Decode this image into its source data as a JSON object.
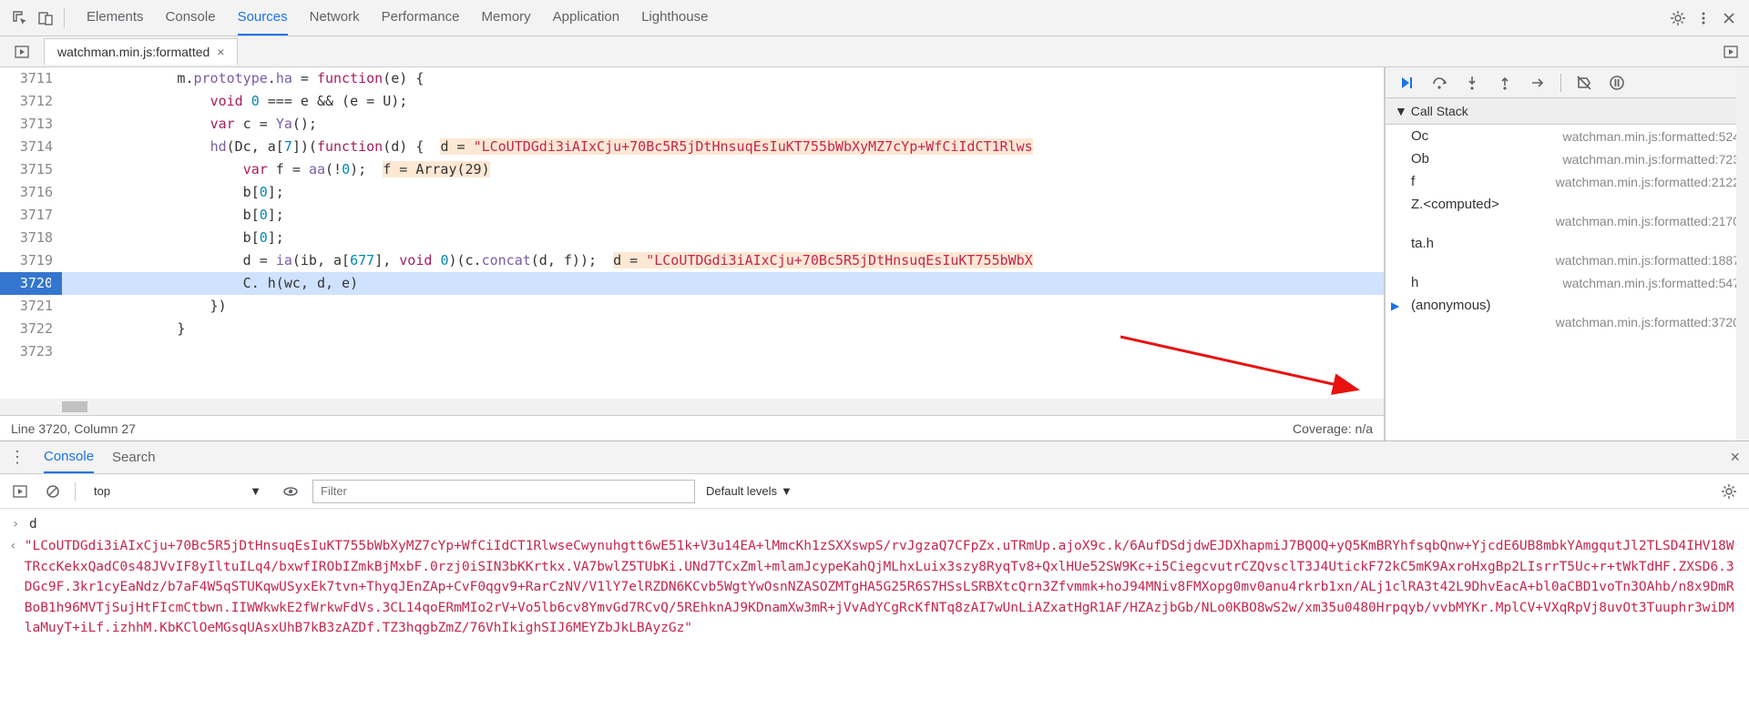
{
  "topTabs": {
    "elements": "Elements",
    "console": "Console",
    "sources": "Sources",
    "network": "Network",
    "performance": "Performance",
    "memory": "Memory",
    "application": "Application",
    "lighthouse": "Lighthouse"
  },
  "fileTab": {
    "name": "watchman.min.js:formatted"
  },
  "code": {
    "lines": [
      {
        "n": 3711,
        "indent": "              ",
        "raw": "m.prototype.ha = function(e) {"
      },
      {
        "n": 3712,
        "indent": "                  ",
        "raw": "void 0 === e && (e = U);"
      },
      {
        "n": 3713,
        "indent": "                  ",
        "raw": "var c = Ya();"
      },
      {
        "n": 3714,
        "indent": "                  ",
        "raw": "hd(Dc, a[7])(function(d) {",
        "hint": "d = \"LCoUTDGdi3iAIxCju+70Bc5R5jDtHnsuqEsIuKT755bWbXyMZ7cYp+WfCiIdCT1Rlws"
      },
      {
        "n": 3715,
        "indent": "                      ",
        "raw": "var f = aa(!0);",
        "hint": "f = Array(29)"
      },
      {
        "n": 3716,
        "indent": "                      ",
        "raw": "b[0];"
      },
      {
        "n": 3717,
        "indent": "                      ",
        "raw": "b[0];"
      },
      {
        "n": 3718,
        "indent": "                      ",
        "raw": "b[0];"
      },
      {
        "n": 3719,
        "indent": "                      ",
        "raw": "d = ia(ib, a[677], void 0)(c.concat(d, f));",
        "hint": "d = \"LCoUTDGdi3iAIxCju+70Bc5R5jDtHnsuqEsIuKT755bWbX"
      },
      {
        "n": 3720,
        "indent": "                      ",
        "raw": "C. h(wc, d, e)",
        "exec": true
      },
      {
        "n": 3721,
        "indent": "                  ",
        "raw": "})"
      },
      {
        "n": 3722,
        "indent": "              ",
        "raw": "}"
      },
      {
        "n": 3723,
        "indent": "",
        "raw": ""
      }
    ]
  },
  "status": {
    "cursor": "Line 3720, Column 27",
    "coverage": "Coverage: n/a"
  },
  "callstack": {
    "title": "Call Stack",
    "frames": [
      {
        "name": "Oc",
        "loc": "watchman.min.js:formatted:524",
        "onerow": true
      },
      {
        "name": "Ob",
        "loc": "watchman.min.js:formatted:723",
        "onerow": true
      },
      {
        "name": "f",
        "loc": "watchman.min.js:formatted:2122",
        "onerow": true
      },
      {
        "name": "Z.<computed>",
        "loc": "watchman.min.js:formatted:2170",
        "onerow": false
      },
      {
        "name": "ta.h",
        "loc": "watchman.min.js:formatted:1887",
        "onerow": false
      },
      {
        "name": "h",
        "loc": "watchman.min.js:formatted:547",
        "onerow": true
      },
      {
        "name": "(anonymous)",
        "loc": "watchman.min.js:formatted:3720",
        "onerow": false,
        "current": true
      }
    ]
  },
  "drawer": {
    "tabs": {
      "console": "Console",
      "search": "Search"
    },
    "context": "top",
    "filterPlaceholder": "Filter",
    "levels": "Default levels"
  },
  "console": {
    "input": "d",
    "output": "\"LCoUTDGdi3iAIxCju+70Bc5R5jDtHnsuqEsIuKT755bWbXyMZ7cYp+WfCiIdCT1RlwseCwynuhgtt6wE51k+V3u14EA+lMmcKh1zSXXswpS/rvJgzaQ7CFpZx.uTRmUp.ajoX9c.k/6AufDSdjdwEJDXhapmiJ7BQOQ+yQ5KmBRYhfsqbQnw+YjcdE6UB8mbkYAmgqutJl2TLSD4IHV18WTRccKekxQadC0s48JVvIF8yIltuILq4/bxwfIRObIZmkBjMxbF.0rzj0iSIN3bKKrtkx.VA7bwlZ5TUbKi.UNd7TCxZml+mlamJcypeKahQjMLhxLuix3szy8RyqTv8+QxlHUe52SW9Kc+i5CiegcvutrCZQvsclT3J4UtickF72kC5mK9AxroHxgBp2LIsrrT5Uc+r+tWkTdHF.ZXSD6.3DGc9F.3kr1cyEaNdz/b7aF4W5qSTUKqwUSyxEk7tvn+ThyqJEnZAp+CvF0qgv9+RarCzNV/V1lY7elRZDN6KCvb5WgtYwOsnNZASOZMTgHA5G25R6S7HSsLSRBXtcQrn3Zfvmmk+hoJ94MNiv8FMXopg0mv0anu4rkrb1xn/ALj1clRA3t42L9DhvEacA+bl0aCBD1voTn3OAhb/n8x9DmRBoB1h96MVTjSujHtFIcmCtbwn.IIWWkwkE2fWrkwFdVs.3CL14qoERmMIo2rV+Vo5lb6cv8YmvGd7RCvQ/5REhknAJ9KDnamXw3mR+jVvAdYCgRcKfNTq8zAI7wUnLiAZxatHgR1AF/HZAzjbGb/NLo0KBO8wS2w/xm35u0480Hrpqyb/vvbMYKr.MplCV+VXqRpVj8uvOt3Tuuphr3wiDMlaMuyT+iLf.izhhM.KbKClOeMGsqUAsxUhB7kB3zAZDf.TZ3hqgbZmZ/76VhIkighSIJ6MEYZbJkLBAyzGz\""
  }
}
